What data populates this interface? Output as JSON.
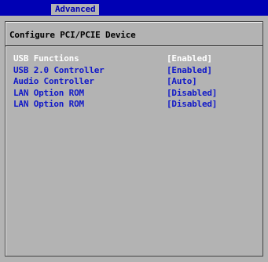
{
  "header": {
    "active_tab": "Advanced"
  },
  "panel": {
    "title": "Configure PCI/PCIE Device"
  },
  "settings": [
    {
      "label": "USB Functions",
      "value": "[Enabled]",
      "selected": true
    },
    {
      "label": "USB 2.0 Controller",
      "value": "[Enabled]",
      "selected": false
    },
    {
      "label": "Audio Controller",
      "value": "[Auto]",
      "selected": false
    },
    {
      "label": "LAN Option ROM",
      "value": "[Disabled]",
      "selected": false
    },
    {
      "label": "LAN Option ROM",
      "value": "[Disabled]",
      "selected": false
    }
  ],
  "colors": {
    "header_bg": "#0000b4",
    "body_bg": "#b3b3b3",
    "item_text": "#1018c8",
    "selected_text": "#ffffff"
  }
}
